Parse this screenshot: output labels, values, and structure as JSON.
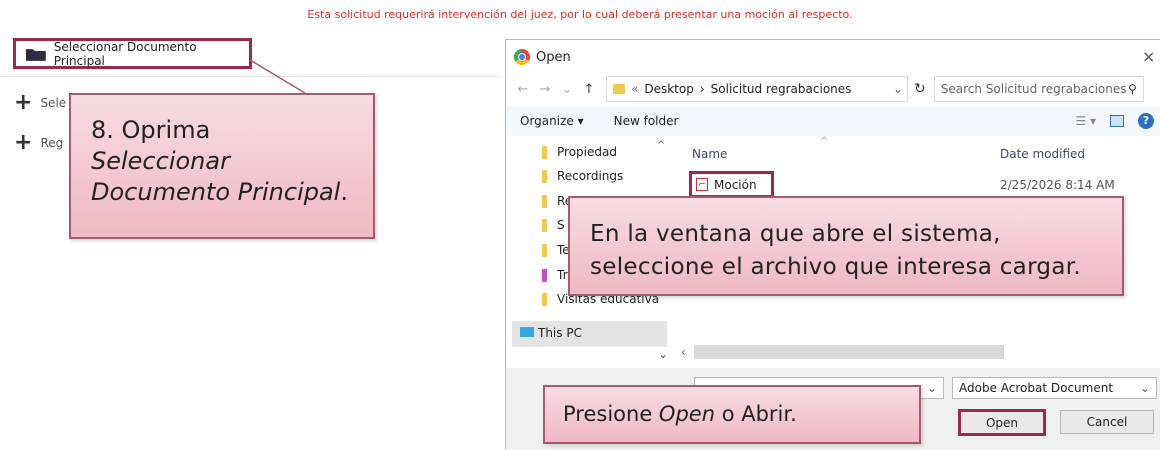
{
  "notice": "Esta solicitud requerirá intervención del juez, por lo cual deberá presentar una moción al respecto.",
  "page": {
    "select_doc_button": "Seleccionar Documento Principal",
    "list_items": [
      {
        "icon": "plus-icon",
        "label": "Sele"
      },
      {
        "icon": "plus-icon",
        "label": "Reg"
      }
    ]
  },
  "callouts": {
    "step8_line1": "8. Oprima",
    "step8_line2": "Seleccionar",
    "step8_line3": "Documento Principal",
    "step8_period": ".",
    "select_file_line1": "En la ventana que abre el sistema,",
    "select_file_line2": "seleccione el archivo que interesa cargar.",
    "press_open_prefix": "Presione ",
    "press_open_em": "Open",
    "press_open_suffix": " o Abrir."
  },
  "dialog": {
    "title": "Open",
    "close_icon": "×",
    "nav": {
      "back": "←",
      "forward": "→",
      "dropdown": "⌄",
      "up": "↑"
    },
    "path": [
      "«",
      "Desktop",
      "›",
      "Solicitud regrabaciones"
    ],
    "path_dropdown": "⌄",
    "refresh": "↻",
    "search_placeholder": "Search Solicitud regrabaciones",
    "search_icon": "⚲",
    "toolbar": {
      "organize": "Organize ▾",
      "new_folder": "New folder"
    },
    "sidebar": [
      {
        "label": "Propiedad",
        "color": "#f2c94c"
      },
      {
        "label": "Recordings",
        "color": "#f2c94c"
      },
      {
        "label": "Re",
        "color": "#f2c94c"
      },
      {
        "label": "S",
        "color": "#f2c94c"
      },
      {
        "label": "Te",
        "color": "#f2c94c"
      },
      {
        "label": "Tr",
        "color": "#c54fbf"
      },
      {
        "label": "Visitas educativa",
        "color": "#f2c94c"
      }
    ],
    "this_pc": "This PC",
    "columns": {
      "name": "Name",
      "date_modified": "Date modified"
    },
    "file": {
      "name": "Moción",
      "date": "2/25/2026 8:14 AM"
    },
    "file_type": "Adobe Acrobat Document",
    "open_button": "Open",
    "cancel_button": "Cancel"
  },
  "colors": {
    "notice": "#e02a2a",
    "highlight_border": "#9b2a4a",
    "callout_fill": "#f2c6d1"
  }
}
